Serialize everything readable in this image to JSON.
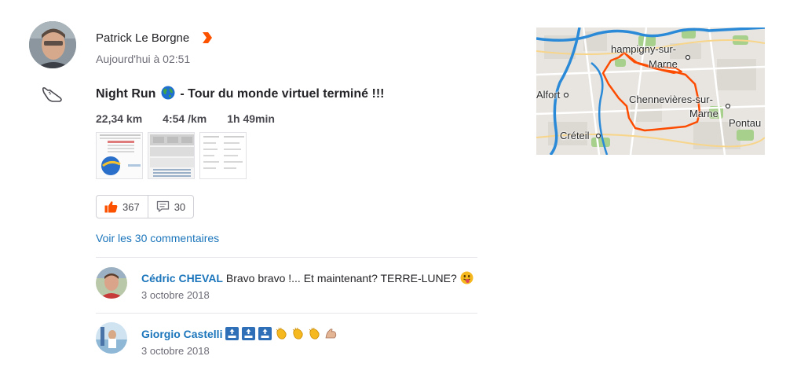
{
  "athlete": {
    "name": "Patrick Le Borgne",
    "timestamp": "Aujourd'hui à 02:51",
    "subscriber_color": "#fc5200"
  },
  "activity": {
    "type_icon": "running-shoe-icon",
    "title_part1": "Night Run",
    "title_icon": "globe-icon",
    "title_part2": "- Tour du monde virtuel terminé !!!",
    "distance": "22,34 km",
    "pace": "4:54 /km",
    "duration": "1h 49min",
    "photo_count": 3
  },
  "actions": {
    "kudos_count": "367",
    "comments_count": "30",
    "view_comments_label": "Voir les 30 commentaires"
  },
  "comments": [
    {
      "author": "Cédric CHEVAL",
      "text": "Bravo bravo !... Et maintenant? TERRE-LUNE?",
      "emoji": "tongue-face-icon",
      "date": "3 octobre 2018"
    },
    {
      "author": "Giorgio Castelli",
      "text": "",
      "emoji": "top-clap-muscle-icons",
      "date": "3 octobre 2018"
    }
  ],
  "map": {
    "labels": {
      "champigny": "hampigny-sur-",
      "marne1": "Marne",
      "alfort": "Alfort",
      "chennevieres": "Chennevières-sur-",
      "marne2": "Marne",
      "pontau": "Pontau",
      "creteil": "Créteil"
    },
    "route_color": "#fc4c02",
    "water_color": "#2b8ad8",
    "park_color": "#a8d08d"
  }
}
